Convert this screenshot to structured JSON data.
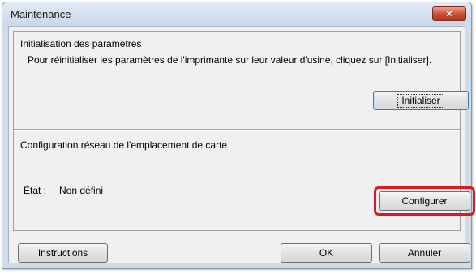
{
  "window": {
    "title": "Maintenance",
    "close_symbol": "✕"
  },
  "init_section": {
    "heading": "Initialisation des paramètres",
    "description": "Pour réinitialiser les paramètres de l'imprimante sur leur valeur d'usine, cliquez sur [Initialiser].",
    "button_label": "Initialiser"
  },
  "network_section": {
    "heading": "Configuration réseau de l'emplacement de carte",
    "status_label": "État :",
    "status_value": "Non défini",
    "button_label": "Configurer"
  },
  "footer": {
    "instructions_label": "Instructions",
    "ok_label": "OK",
    "cancel_label": "Annuler"
  },
  "colors": {
    "highlight": "#e0181e",
    "focus_border": "#3c7fb1"
  },
  "icons": {
    "close": "close-icon"
  }
}
